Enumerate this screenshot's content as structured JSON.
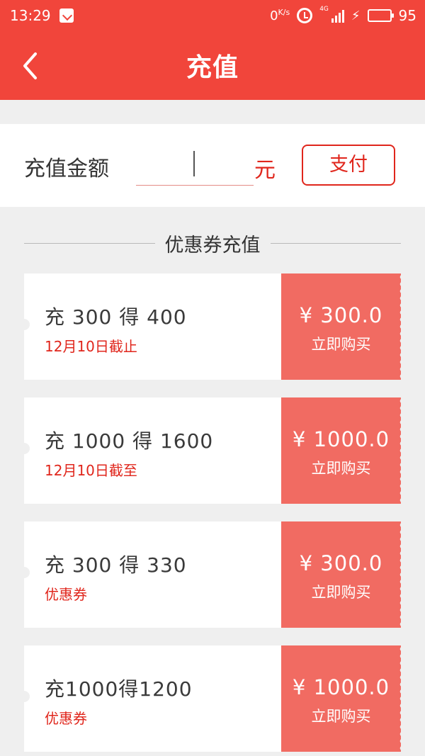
{
  "status_bar": {
    "time": "13:29",
    "speed": "0",
    "speed_unit": "K/s",
    "network": "4G",
    "battery": "95"
  },
  "header": {
    "title": "充值",
    "back_icon": "chevron-left-icon"
  },
  "amount": {
    "label": "充值金额",
    "value": "",
    "unit": "元",
    "pay_label": "支付"
  },
  "section": {
    "title": "优惠券充值"
  },
  "coupons": [
    {
      "main": "充 300 得 400",
      "sub": "12月10日截止",
      "price": "¥ 300.0",
      "buy": "立即购买"
    },
    {
      "main": "充 1000 得 1600",
      "sub": "12月10日截至",
      "price": "¥ 1000.0",
      "buy": "立即购买"
    },
    {
      "main": "充 300 得 330",
      "sub": "优惠券",
      "price": "¥ 300.0",
      "buy": "立即购买"
    },
    {
      "main": "充1000得1200",
      "sub": "优惠券",
      "price": "¥ 1000.0",
      "buy": "立即购买"
    }
  ],
  "colors": {
    "brand_red": "#f1453b",
    "accent_red": "#e0261c",
    "coupon_price_bg": "#f16b62",
    "page_bg": "#efefef"
  }
}
